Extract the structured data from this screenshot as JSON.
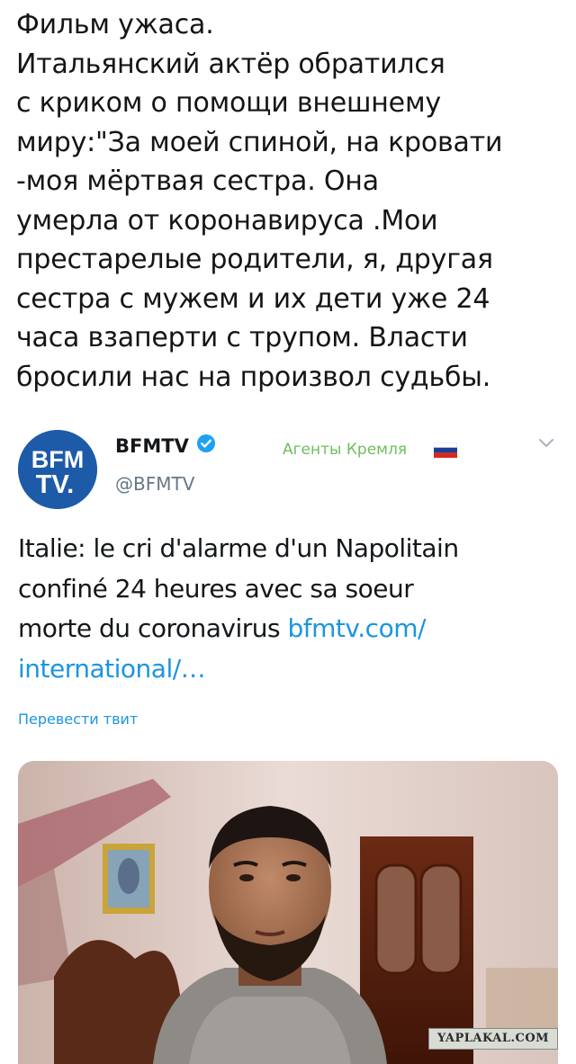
{
  "caption": {
    "lines": [
      "Фильм ужаса.",
      "Итальянский актёр обратился",
      "с криком о помощи внешнему",
      "миру:\"За моей спиной, на кровати",
      "-моя мёртвая сестра. Она",
      "умерла от коронавируса .Мои",
      "престарелые родители, я, другая",
      "сестра с мужем и их дети уже 24",
      "часа взаперти с трупом. Власти",
      "бросили нас на произвол судьбы."
    ]
  },
  "tweet": {
    "logo_line1": "BFM",
    "logo_line2": "TV.",
    "author_name": "BFMTV",
    "handle": "@BFMTV",
    "label": "Агенты Кремля",
    "text_lines": [
      "Italie: le cri d'alarme d'un Napolitain",
      "confiné 24 heures avec sa soeur",
      "morte du coronavirus "
    ],
    "link_part1": "bfmtv.com/",
    "link_part2": "international/…",
    "translate_label": "Перевести твит"
  },
  "watermark": "YAPLAKAL.COM",
  "colors": {
    "link": "#1b95e0",
    "label": "#6fbf5c",
    "logo_bg": "#1d5ba9",
    "handle": "#657786"
  },
  "icons": [
    "verified-badge-icon",
    "russia-flag-icon",
    "chevron-down-icon"
  ]
}
